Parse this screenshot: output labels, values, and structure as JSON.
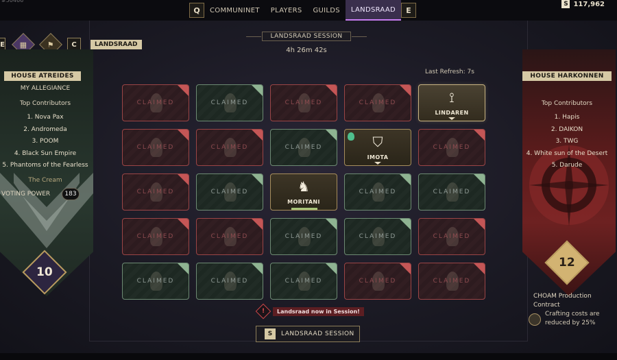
{
  "topbar": {
    "uid": "#50466",
    "left_key": "Q",
    "right_key": "E",
    "tabs": [
      {
        "label": "COMMUNINET",
        "active": false
      },
      {
        "label": "PLAYERS",
        "active": false
      },
      {
        "label": "GUILDS",
        "active": false
      },
      {
        "label": "LANDSRAAD",
        "active": true
      }
    ],
    "currency_symbol": "S",
    "currency_value": "117,962"
  },
  "breadcrumb": {
    "left_cut_key": "E",
    "diamond_1": "▦",
    "diamond_2": "⚑",
    "key": "C",
    "label": "LANDSRAAD"
  },
  "session": {
    "title": "LANDSRAAD SESSION",
    "time_left": "4h 26m 42s",
    "refresh_label": "Last Refresh:",
    "refresh_value": "7s"
  },
  "atreides": {
    "house": "HOUSE ATREIDES",
    "subtitle": "MY ALLEGIANCE",
    "contributors_title": "Top Contributors",
    "contributors": [
      "1. Nova Pax",
      "2. Andromeda",
      "3. POOM",
      "4. Black Sun Empire",
      "5. Phantoms of the Fearless"
    ],
    "guild_name": "The Cream",
    "voting_power_label": "VOTING POWER",
    "voting_power_value": "183",
    "rank": "10",
    "color": "#2a3a30"
  },
  "harkonnen": {
    "house": "HOUSE HARKONNEN",
    "contributors_title": "Top Contributors",
    "contributors": [
      "1. Hapis",
      "2. DAIKON",
      "3. TWG",
      "4. White sun of the Desert",
      "5. Darude"
    ],
    "rank": "12",
    "reward_title": "CHOAM Production Contract",
    "reward_desc": "Crafting costs are reduced by 25%",
    "color": "#6d2121"
  },
  "grid": {
    "claimed_text": "CLAIMED",
    "tiles": [
      {
        "state": "claimed-red"
      },
      {
        "state": "claimed-green"
      },
      {
        "state": "claimed-red"
      },
      {
        "state": "claimed-red"
      },
      {
        "state": "owned",
        "name": "LINDAREN",
        "icon": "⟟",
        "active": true
      },
      {
        "state": "claimed-red"
      },
      {
        "state": "claimed-red"
      },
      {
        "state": "claimed-green"
      },
      {
        "state": "owned",
        "name": "IMOTA",
        "icon": "⛉",
        "active": false,
        "shield": true
      },
      {
        "state": "claimed-red"
      },
      {
        "state": "claimed-red"
      },
      {
        "state": "claimed-green"
      },
      {
        "state": "owned",
        "name": "MORITANI",
        "icon": "♞",
        "active": false,
        "bar": true
      },
      {
        "state": "claimed-green"
      },
      {
        "state": "claimed-green"
      },
      {
        "state": "claimed-red"
      },
      {
        "state": "claimed-red"
      },
      {
        "state": "claimed-green"
      },
      {
        "state": "claimed-green"
      },
      {
        "state": "claimed-red"
      },
      {
        "state": "claimed-green"
      },
      {
        "state": "claimed-green"
      },
      {
        "state": "claimed-green"
      },
      {
        "state": "claimed-red"
      },
      {
        "state": "claimed-red"
      }
    ]
  },
  "alert": {
    "icon": "!",
    "text": "Landsraad now in Session!"
  },
  "action": {
    "key": "S",
    "label": "LANDSRAAD SESSION"
  }
}
